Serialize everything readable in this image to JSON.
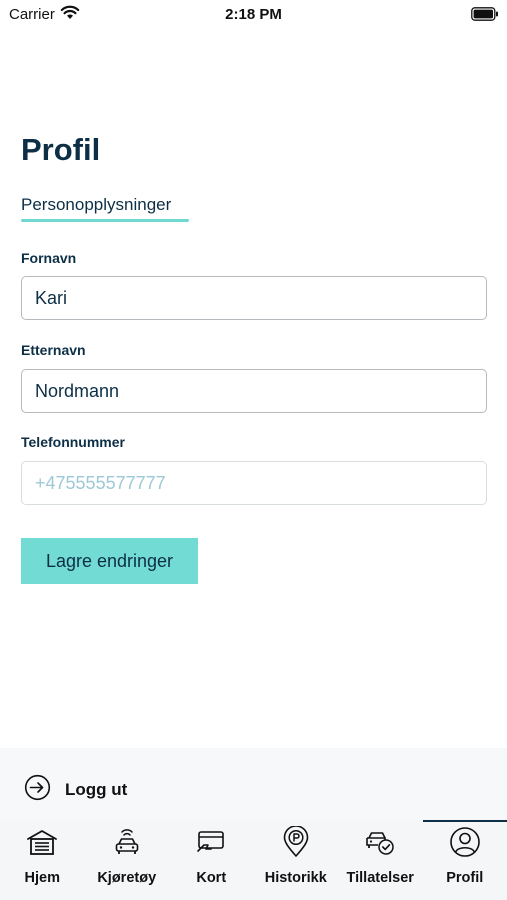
{
  "status_bar": {
    "carrier": "Carrier",
    "time": "2:18 PM"
  },
  "page": {
    "title": "Profil"
  },
  "section_tab": {
    "label": "Personopplysninger"
  },
  "form": {
    "first_name": {
      "label": "Fornavn",
      "value": "Kari",
      "placeholder": ""
    },
    "last_name": {
      "label": "Etternavn",
      "value": "Nordmann",
      "placeholder": ""
    },
    "phone": {
      "label": "Telefonnummer",
      "value": "",
      "placeholder": "+475555577777"
    },
    "save_label": "Lagre endringer"
  },
  "logout": {
    "label": "Logg ut",
    "icon": "logout-arrow-icon"
  },
  "tab_bar": {
    "active": "Profil",
    "items": [
      {
        "label": "Hjem",
        "icon": "garage-icon"
      },
      {
        "label": "Kjøretøy",
        "icon": "car-icon"
      },
      {
        "label": "Kort",
        "icon": "card-icon"
      },
      {
        "label": "Historikk",
        "icon": "parking-pin-icon"
      },
      {
        "label": "Tillatelser",
        "icon": "car-check-icon"
      },
      {
        "label": "Profil",
        "icon": "user-icon"
      }
    ]
  },
  "colors": {
    "primary": "#0d2f46",
    "accent": "#72dbd3",
    "placeholder": "#9dc9d6"
  }
}
